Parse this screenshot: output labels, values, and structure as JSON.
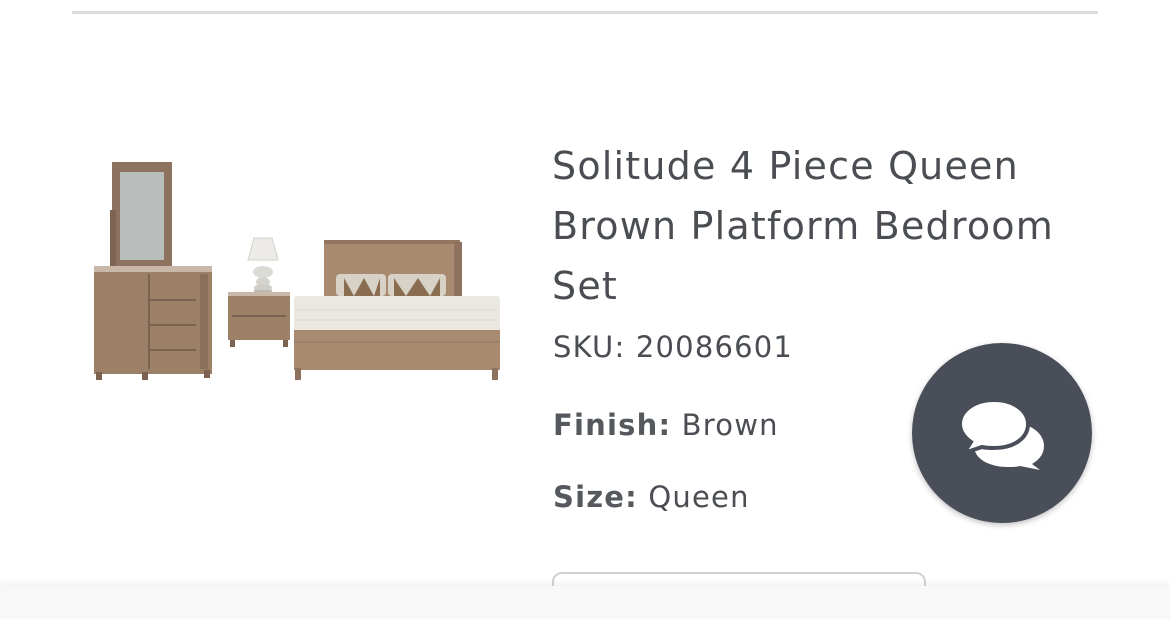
{
  "product": {
    "title": "Solitude 4 Piece Queen Brown Platform Bedroom Set",
    "sku_label": "SKU:",
    "sku_value": "20086601",
    "finish_label": "Finish:",
    "finish_value": "Brown",
    "size_label": "Size:",
    "size_value": "Queen",
    "image_icon": "bedroom-set-image"
  },
  "chat": {
    "icon": "chat-bubbles-icon",
    "background": "#494e59"
  },
  "colors": {
    "text": "#4a4d52",
    "wood": "#9c8068",
    "divider": "#dcdcdc"
  }
}
